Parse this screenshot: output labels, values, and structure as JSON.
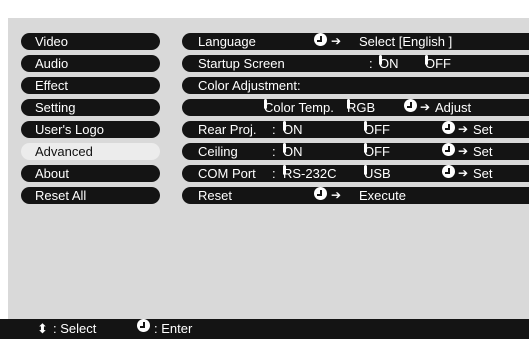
{
  "menu": {
    "items": [
      {
        "label": "Video"
      },
      {
        "label": "Audio"
      },
      {
        "label": "Effect"
      },
      {
        "label": "Setting"
      },
      {
        "label": "User's Logo"
      },
      {
        "label": "Advanced",
        "selected": true
      },
      {
        "label": "About"
      },
      {
        "label": "Reset All"
      }
    ]
  },
  "settings": {
    "language": {
      "label": "Language",
      "action": "Select [English  ]"
    },
    "startup_screen": {
      "label": "Startup Screen",
      "sep": ":",
      "opt_on": "ON",
      "opt_off": "OFF"
    },
    "color_adjustment": {
      "label": "Color Adjustment:",
      "opt_temp": "Color Temp.",
      "opt_rgb": "RGB",
      "action": "Adjust"
    },
    "rear_proj": {
      "label": "Rear Proj.",
      "sep": ":",
      "opt_on": "ON",
      "opt_off": "OFF",
      "action": "Set"
    },
    "ceiling": {
      "label": "Ceiling",
      "sep": ":",
      "opt_on": "ON",
      "opt_off": "OFF",
      "action": "Set"
    },
    "com_port": {
      "label": "COM Port",
      "sep": ":",
      "opt_rs232c": "RS-232C",
      "opt_usb": "USB",
      "action": "Set"
    },
    "reset": {
      "label": "Reset",
      "action": "Execute"
    }
  },
  "footer": {
    "select_hint": ": Select",
    "enter_hint": ": Enter"
  },
  "icons": {
    "updown": "updown-arrows-icon",
    "enter": "enter-button-icon",
    "arrow": "right-arrow-icon"
  },
  "colors": {
    "bar": "#141414",
    "panel": "#d9d9d9",
    "selected": "#ececec"
  }
}
